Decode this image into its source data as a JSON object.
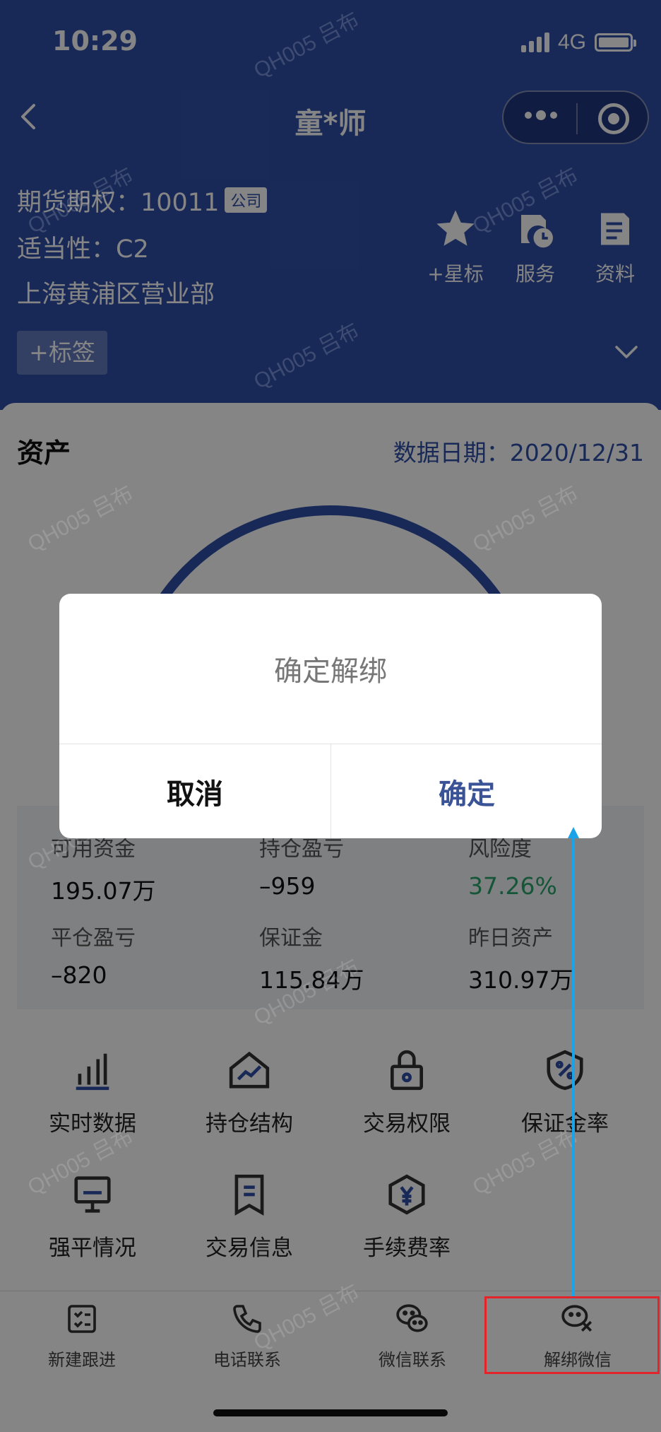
{
  "status_bar": {
    "time": "10:29",
    "network": "4G"
  },
  "header": {
    "title": "童*师",
    "account_label": "期货期权：10011",
    "account_badge": "公司",
    "suitability": "适当性：C2",
    "branch": "上海黄浦区营业部",
    "tag_button": "+标签",
    "actions": [
      {
        "label": "+星标",
        "icon": "star-icon"
      },
      {
        "label": "服务",
        "icon": "service-clock-icon"
      },
      {
        "label": "资料",
        "icon": "document-icon"
      }
    ]
  },
  "assets": {
    "title": "资产",
    "date": "数据日期：2020/12/31",
    "stats": [
      {
        "label": "可用资金",
        "value": "195.07万"
      },
      {
        "label": "持仓盈亏",
        "value": "–959"
      },
      {
        "label": "风险度",
        "value": "37.26%"
      },
      {
        "label": "平仓盈亏",
        "value": "–820"
      },
      {
        "label": "保证金",
        "value": "115.84万"
      },
      {
        "label": "昨日资产",
        "value": "310.97万"
      }
    ]
  },
  "grid": [
    {
      "label": "实时数据",
      "icon": "bar-chart-icon"
    },
    {
      "label": "持仓结构",
      "icon": "house-trend-icon"
    },
    {
      "label": "交易权限",
      "icon": "lock-icon"
    },
    {
      "label": "保证金率",
      "icon": "shield-percent-icon"
    },
    {
      "label": "强平情况",
      "icon": "monitor-icon"
    },
    {
      "label": "交易信息",
      "icon": "receipt-icon"
    },
    {
      "label": "手续费率",
      "icon": "hexagon-yen-icon"
    }
  ],
  "bottom_bar": [
    {
      "label": "新建跟进",
      "icon": "checklist-icon"
    },
    {
      "label": "电话联系",
      "icon": "phone-icon"
    },
    {
      "label": "微信联系",
      "icon": "wechat-icon"
    },
    {
      "label": "解绑微信",
      "icon": "wechat-unbind-icon"
    }
  ],
  "dialog": {
    "message": "确定解绑",
    "cancel": "取消",
    "confirm": "确定"
  },
  "watermark": "QH005 吕布",
  "colors": {
    "header_blue": "#2f4fa8",
    "risk_green": "#2aa36b",
    "dialog_confirm": "#3a5396",
    "annotation_red": "#e3242b",
    "annotation_arrow": "#1aa3e8"
  }
}
